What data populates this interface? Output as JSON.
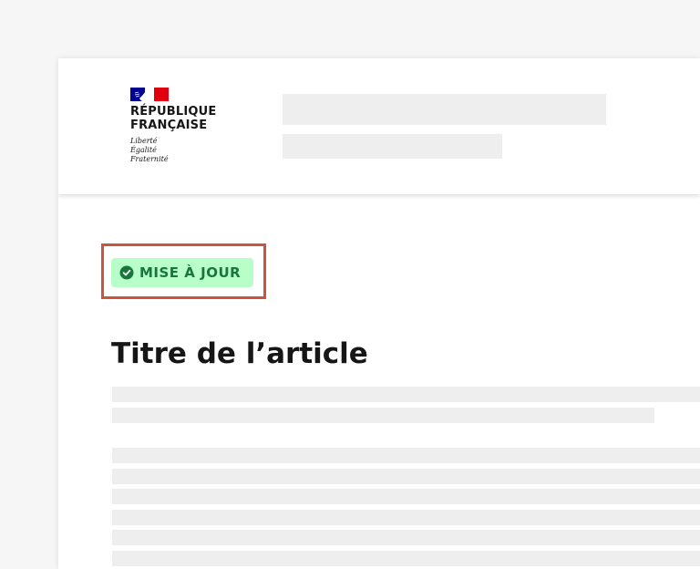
{
  "header": {
    "logo": {
      "name_lines": [
        "RÉPUBLIQUE",
        "FRANÇAISE"
      ],
      "motto_lines": [
        "Liberté",
        "Égalité",
        "Fraternité"
      ],
      "flag_colors": [
        "#000091",
        "#ffffff",
        "#e1000f"
      ]
    }
  },
  "badge": {
    "label": "MISE À JOUR",
    "icon": "check-circle-icon",
    "background": "#b8fec9",
    "text_color": "#18753c"
  },
  "highlight": {
    "color": "#c9553f"
  },
  "article": {
    "title": "Titre de l’article"
  }
}
